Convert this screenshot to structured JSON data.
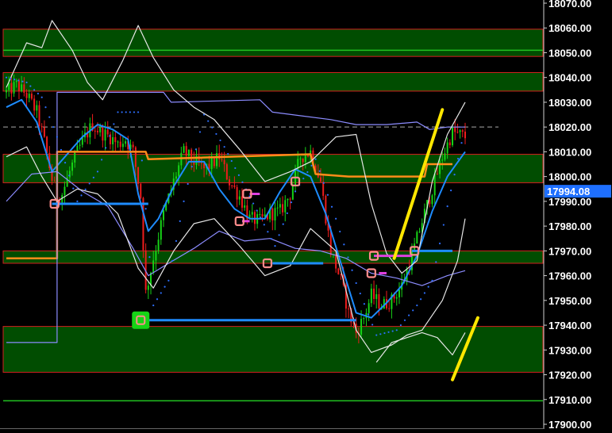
{
  "chart_data": {
    "type": "candlestick",
    "y_axis": {
      "side": "right",
      "ylim": [
        17900,
        18070
      ],
      "ticks": [
        18070,
        18060,
        18050,
        18040,
        18030,
        18020,
        18010,
        18000,
        17990,
        17980,
        17970,
        17960,
        17950,
        17940,
        17930,
        17920,
        17910,
        17900
      ],
      "tick_labels": [
        "18070.00",
        "18060.00",
        "18050.00",
        "18040.00",
        "18030.00",
        "18020.00",
        "18010.00",
        "18000.00",
        "17990.00",
        "17980.00",
        "17970.00",
        "17960.00",
        "17950.00",
        "17940.00",
        "17930.00",
        "17920.00",
        "17910.00",
        "17900.00"
      ]
    },
    "current_price": {
      "value": 17994.08,
      "label": "17994.08",
      "color": "#1e6fff"
    },
    "dashed_level": 18020,
    "zones": [
      {
        "from": 18048.5,
        "to": 18059.5
      },
      {
        "from": 18034.5,
        "to": 18042
      },
      {
        "from": 17997.5,
        "to": 18009
      },
      {
        "from": 17965,
        "to": 17970
      },
      {
        "from": 17921,
        "to": 17939.5
      }
    ],
    "green_lines": [
      18051,
      17909.5
    ],
    "candles": {
      "count": 182,
      "x_range": [
        0,
        181
      ],
      "anchors": [
        [
          0,
          18034
        ],
        [
          4,
          18037
        ],
        [
          8,
          18033
        ],
        [
          12,
          18026
        ],
        [
          15,
          18014
        ],
        [
          18,
          17999
        ],
        [
          20,
          17992
        ],
        [
          22,
          17993
        ],
        [
          25,
          18002
        ],
        [
          28,
          18010
        ],
        [
          31,
          18016
        ],
        [
          34,
          18021
        ],
        [
          37,
          18018
        ],
        [
          41,
          18016
        ],
        [
          44,
          18013
        ],
        [
          47,
          18015
        ],
        [
          50,
          18010
        ],
        [
          53,
          17992
        ],
        [
          55,
          17953
        ],
        [
          58,
          17967
        ],
        [
          62,
          17985
        ],
        [
          66,
          17998
        ],
        [
          70,
          18010
        ],
        [
          74,
          18006
        ],
        [
          78,
          18003
        ],
        [
          81,
          18005
        ],
        [
          84,
          18008
        ],
        [
          88,
          17998
        ],
        [
          92,
          17992
        ],
        [
          96,
          17983
        ],
        [
          100,
          17982
        ],
        [
          104,
          17985
        ],
        [
          108,
          17986
        ],
        [
          112,
          17993
        ],
        [
          116,
          18008
        ],
        [
          120,
          18010
        ],
        [
          124,
          17998
        ],
        [
          128,
          17970
        ],
        [
          132,
          17958
        ],
        [
          135,
          17945
        ],
        [
          138,
          17937
        ],
        [
          141,
          17943
        ],
        [
          144,
          17952
        ],
        [
          148,
          17948
        ],
        [
          152,
          17950
        ],
        [
          156,
          17956
        ],
        [
          160,
          17968
        ],
        [
          164,
          17982
        ],
        [
          168,
          17995
        ],
        [
          172,
          18008
        ],
        [
          176,
          18018
        ],
        [
          181,
          18016
        ]
      ],
      "up_color": "#16d416",
      "down_color": "#ee1c1c"
    },
    "series": [
      {
        "color": "#1e8cff",
        "points": [
          [
            0,
            18028
          ],
          [
            6,
            18031
          ],
          [
            12,
            18022
          ],
          [
            18,
            18002
          ],
          [
            24,
            18009
          ],
          [
            30,
            18016
          ],
          [
            36,
            18021
          ],
          [
            42,
            18019
          ],
          [
            48,
            18015
          ],
          [
            52,
            17993
          ],
          [
            56,
            17978
          ],
          [
            60,
            17983
          ],
          [
            66,
            17996
          ],
          [
            72,
            18006
          ],
          [
            78,
            18006
          ],
          [
            84,
            17995
          ],
          [
            90,
            17987
          ],
          [
            96,
            17983
          ],
          [
            102,
            17983
          ],
          [
            108,
            17994
          ],
          [
            114,
            18003
          ],
          [
            120,
            18000
          ],
          [
            126,
            17985
          ],
          [
            132,
            17965
          ],
          [
            138,
            17945
          ],
          [
            144,
            17943
          ],
          [
            150,
            17949
          ],
          [
            156,
            17956
          ],
          [
            162,
            17968
          ],
          [
            168,
            17986
          ],
          [
            174,
            18000
          ],
          [
            181,
            18010
          ]
        ]
      },
      {
        "color": "#ff8c1a",
        "points": [
          [
            0,
            17967
          ],
          [
            20,
            17967
          ],
          [
            20,
            18010
          ],
          [
            55,
            18010
          ],
          [
            56,
            18007
          ],
          [
            120,
            18009
          ],
          [
            122,
            18001
          ],
          [
            135,
            18000
          ],
          [
            165,
            18000
          ],
          [
            166,
            18005
          ],
          [
            176,
            18005
          ]
        ]
      },
      {
        "color": "#8c8cff",
        "points": [
          [
            0,
            17933
          ],
          [
            20,
            17933
          ],
          [
            20,
            18034
          ],
          [
            62,
            18034
          ],
          [
            65,
            18030
          ],
          [
            100,
            18031
          ],
          [
            105,
            18026
          ],
          [
            128,
            18023
          ],
          [
            138,
            18021
          ],
          [
            150,
            18021
          ],
          [
            162,
            18022
          ],
          [
            167,
            18019
          ],
          [
            174,
            18020
          ],
          [
            181,
            18020
          ]
        ]
      },
      {
        "color": "#8c8cff",
        "points": [
          [
            0,
            17990
          ],
          [
            10,
            18001
          ],
          [
            20,
            18002
          ],
          [
            30,
            17994
          ],
          [
            40,
            17988
          ],
          [
            50,
            17971
          ],
          [
            56,
            17960
          ],
          [
            64,
            17965
          ],
          [
            74,
            17971
          ],
          [
            84,
            17978
          ],
          [
            94,
            17974
          ],
          [
            104,
            17975
          ],
          [
            114,
            17971
          ],
          [
            124,
            17970
          ],
          [
            134,
            17967
          ],
          [
            144,
            17961
          ],
          [
            154,
            17959
          ],
          [
            164,
            17956
          ],
          [
            174,
            17960
          ],
          [
            181,
            17962
          ]
        ]
      },
      {
        "color": "#e6e6e6",
        "points": [
          [
            0,
            18036
          ],
          [
            8,
            18054
          ],
          [
            14,
            18052
          ],
          [
            18,
            18063
          ],
          [
            26,
            18051
          ],
          [
            32,
            18038
          ],
          [
            38,
            18031
          ],
          [
            46,
            18047
          ],
          [
            52,
            18061
          ],
          [
            58,
            18048
          ],
          [
            66,
            18035
          ],
          [
            74,
            18028
          ],
          [
            82,
            18023
          ],
          [
            92,
            18011
          ],
          [
            102,
            17998
          ],
          [
            112,
            18002
          ],
          [
            120,
            18006
          ],
          [
            130,
            18016
          ],
          [
            138,
            18017
          ],
          [
            144,
            17989
          ],
          [
            150,
            17969
          ],
          [
            156,
            17961
          ],
          [
            162,
            17966
          ],
          [
            168,
            17998
          ],
          [
            174,
            18017
          ],
          [
            181,
            18030
          ]
        ]
      },
      {
        "color": "#e6e6e6",
        "points": [
          [
            0,
            18008
          ],
          [
            8,
            18012
          ],
          [
            14,
            18000
          ],
          [
            20,
            17990
          ],
          [
            28,
            17995
          ],
          [
            36,
            17993
          ],
          [
            44,
            17985
          ],
          [
            52,
            17963
          ],
          [
            58,
            17955
          ],
          [
            66,
            17970
          ],
          [
            74,
            17981
          ],
          [
            82,
            17983
          ],
          [
            92,
            17972
          ],
          [
            102,
            17960
          ],
          [
            112,
            17964
          ],
          [
            120,
            17979
          ],
          [
            130,
            17970
          ],
          [
            138,
            17938
          ],
          [
            144,
            17929
          ],
          [
            152,
            17932
          ],
          [
            158,
            17936
          ],
          [
            164,
            17938
          ],
          [
            172,
            17950
          ],
          [
            178,
            17966
          ],
          [
            181,
            17983
          ]
        ]
      },
      {
        "color": "#e6e6e6",
        "points": [
          [
            146,
            17925
          ],
          [
            152,
            17933
          ],
          [
            158,
            17935
          ],
          [
            164,
            17937
          ],
          [
            170,
            17935
          ],
          [
            176,
            17928
          ],
          [
            181,
            17937
          ]
        ]
      }
    ],
    "dotted_series": {
      "color": "#2d6fff",
      "points": [
        [
          0,
          18040
        ],
        [
          8,
          18038
        ],
        [
          14,
          18032
        ],
        [
          20,
          18016
        ],
        [
          28,
          17990
        ],
        [
          36,
          18002
        ],
        [
          44,
          18026
        ],
        [
          52,
          18026
        ],
        [
          58,
          17948
        ],
        [
          64,
          17958
        ],
        [
          70,
          17990
        ],
        [
          78,
          18025
        ],
        [
          86,
          18012
        ],
        [
          96,
          17992
        ],
        [
          106,
          17972
        ],
        [
          114,
          17994
        ],
        [
          122,
          18007
        ],
        [
          130,
          17983
        ],
        [
          138,
          17957
        ],
        [
          146,
          17936
        ],
        [
          154,
          17938
        ],
        [
          162,
          17948
        ],
        [
          168,
          17958
        ],
        [
          174,
          17988
        ],
        [
          181,
          18020
        ]
      ]
    },
    "level_lines": [
      {
        "from": 18,
        "to": 56,
        "y": 17989,
        "color": "#1e8cff"
      },
      {
        "from": 55,
        "to": 138,
        "y": 17942,
        "color": "#1e8cff"
      },
      {
        "from": 105,
        "to": 125,
        "y": 17965,
        "color": "#1e8cff"
      },
      {
        "from": 160,
        "to": 176,
        "y": 17970,
        "color": "#1e8cff"
      },
      {
        "from": 145,
        "to": 160,
        "y": 17968,
        "color": "#e040e0"
      },
      {
        "from": 96,
        "to": 100,
        "y": 17993,
        "color": "#e040e0"
      },
      {
        "from": 93,
        "to": 96,
        "y": 17982,
        "color": "#e040e0"
      },
      {
        "from": 147,
        "to": 150,
        "y": 17961,
        "color": "#e040e0"
      }
    ],
    "markers": [
      {
        "x": 19,
        "y": 17989,
        "style": "pink"
      },
      {
        "x": 95,
        "y": 17993,
        "style": "pink"
      },
      {
        "x": 92,
        "y": 17982,
        "style": "pink"
      },
      {
        "x": 114,
        "y": 17998,
        "style": "pink"
      },
      {
        "x": 103,
        "y": 17965,
        "style": "pink"
      },
      {
        "x": 145,
        "y": 17968,
        "style": "pink"
      },
      {
        "x": 144,
        "y": 17961,
        "style": "pink"
      },
      {
        "x": 161,
        "y": 17970,
        "style": "pink"
      },
      {
        "x": 53,
        "y": 17942,
        "style": "green"
      }
    ],
    "annotations": [
      {
        "type": "trend_line",
        "color": "#ffe600",
        "from": [
          153,
          17967
        ],
        "to": [
          172,
          18027
        ]
      },
      {
        "type": "trend_line",
        "color": "#ffe600",
        "from": [
          176,
          17918
        ],
        "to": [
          186,
          17943
        ]
      }
    ]
  }
}
